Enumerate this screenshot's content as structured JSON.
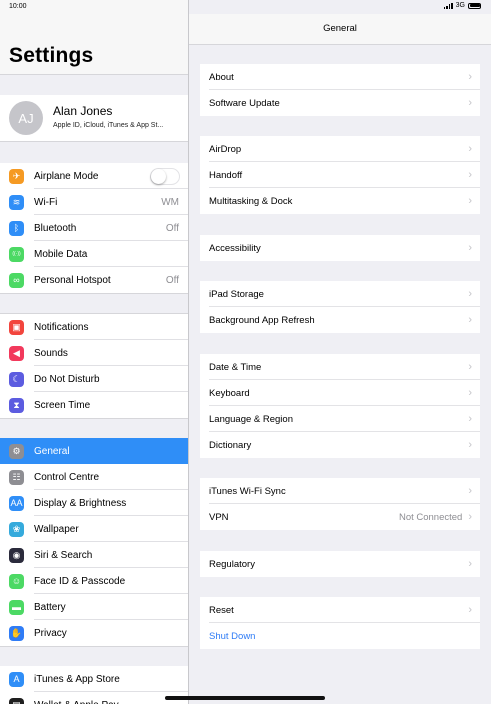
{
  "status": {
    "time": "10:00",
    "network": "3G"
  },
  "sidebar": {
    "title": "Settings",
    "profile": {
      "initials": "AJ",
      "name": "Alan Jones",
      "subtitle": "Apple ID, iCloud, iTunes & App St..."
    },
    "group1": [
      {
        "label": "Airplane Mode",
        "icon": "airplane-icon",
        "color": "#f59a23",
        "value": "",
        "toggle": true
      },
      {
        "label": "Wi-Fi",
        "icon": "wifi-icon",
        "color": "#2f8ef7",
        "value": "WM"
      },
      {
        "label": "Bluetooth",
        "icon": "bluetooth-icon",
        "color": "#2f8ef7",
        "value": "Off"
      },
      {
        "label": "Mobile Data",
        "icon": "antenna-icon",
        "color": "#4cd964",
        "value": ""
      },
      {
        "label": "Personal Hotspot",
        "icon": "hotspot-icon",
        "color": "#4cd964",
        "value": "Off"
      }
    ],
    "group2": [
      {
        "label": "Notifications",
        "icon": "notifications-icon",
        "color": "#f2453d"
      },
      {
        "label": "Sounds",
        "icon": "speaker-icon",
        "color": "#f2395c"
      },
      {
        "label": "Do Not Disturb",
        "icon": "moon-icon",
        "color": "#5c5ce0"
      },
      {
        "label": "Screen Time",
        "icon": "hourglass-icon",
        "color": "#5c5ce0"
      }
    ],
    "group3": [
      {
        "label": "General",
        "icon": "gear-icon",
        "color": "#8e8e93"
      },
      {
        "label": "Control Centre",
        "icon": "toggles-icon",
        "color": "#8e8e93"
      },
      {
        "label": "Display & Brightness",
        "icon": "text-size-icon",
        "color": "#2f8ef7"
      },
      {
        "label": "Wallpaper",
        "icon": "flower-icon",
        "color": "#35aadc"
      },
      {
        "label": "Siri & Search",
        "icon": "siri-icon",
        "color": "#2b2b3c"
      },
      {
        "label": "Face ID & Passcode",
        "icon": "face-id-icon",
        "color": "#4cd964"
      },
      {
        "label": "Battery",
        "icon": "battery-icon",
        "color": "#4cd964"
      },
      {
        "label": "Privacy",
        "icon": "hand-icon",
        "color": "#2f7cf6"
      }
    ],
    "group4": [
      {
        "label": "iTunes & App Store",
        "icon": "app-store-icon",
        "color": "#2f8ef7"
      },
      {
        "label": "Wallet & Apple Pay",
        "icon": "wallet-icon",
        "color": "#1f1f1f"
      }
    ]
  },
  "detail": {
    "title": "General",
    "groups": [
      [
        {
          "label": "About"
        },
        {
          "label": "Software Update"
        }
      ],
      [
        {
          "label": "AirDrop"
        },
        {
          "label": "Handoff"
        },
        {
          "label": "Multitasking & Dock"
        }
      ],
      [
        {
          "label": "Accessibility"
        }
      ],
      [
        {
          "label": "iPad Storage"
        },
        {
          "label": "Background App Refresh"
        }
      ],
      [
        {
          "label": "Date & Time"
        },
        {
          "label": "Keyboard"
        },
        {
          "label": "Language & Region"
        },
        {
          "label": "Dictionary"
        }
      ],
      [
        {
          "label": "iTunes Wi-Fi Sync"
        },
        {
          "label": "VPN",
          "value": "Not Connected"
        }
      ],
      [
        {
          "label": "Regulatory"
        }
      ],
      [
        {
          "label": "Reset"
        },
        {
          "label": "Shut Down",
          "link": true
        }
      ]
    ]
  }
}
